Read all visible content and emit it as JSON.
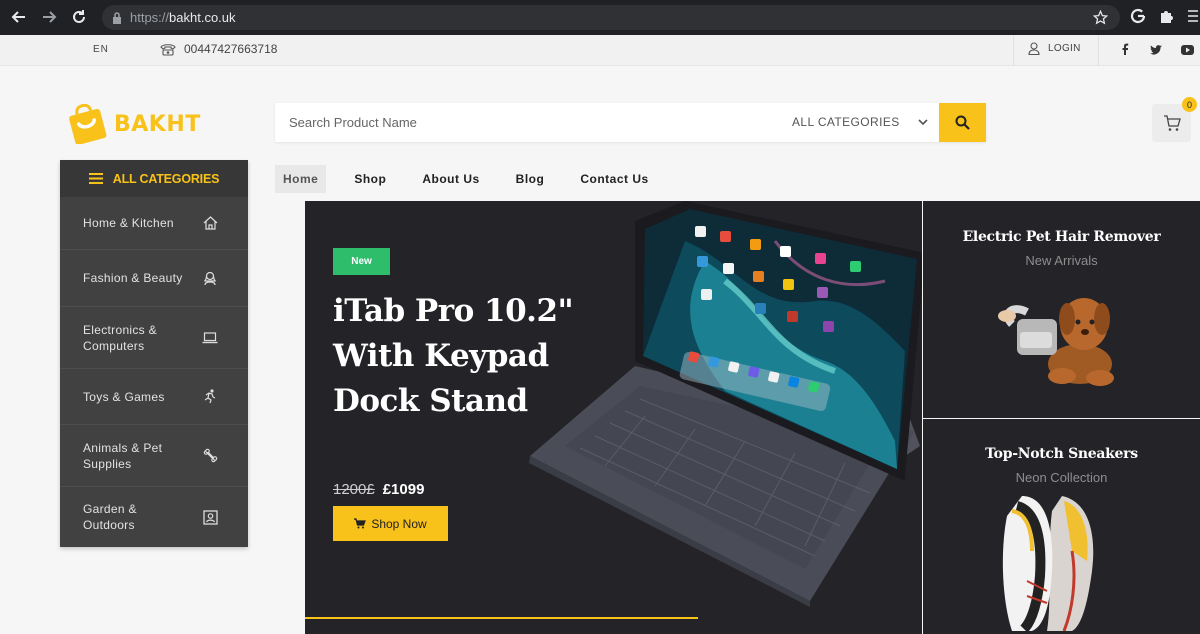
{
  "browser": {
    "url_protocol": "https://",
    "url_host": "bakht.co.uk"
  },
  "topbar": {
    "language": "EN",
    "phone": "00447427663718",
    "login": "LOGIN"
  },
  "brand": {
    "name": "BAKHT",
    "accent_color": "#f8c21a"
  },
  "search": {
    "placeholder": "Search Product Name",
    "category": "ALL CATEGORIES"
  },
  "cart": {
    "count": "0"
  },
  "sidebar": {
    "heading": "ALL CATEGORIES",
    "items": [
      {
        "label": "Home & Kitchen",
        "icon": "home-icon"
      },
      {
        "label": "Fashion & Beauty",
        "icon": "woman-icon"
      },
      {
        "label": "Electronics & Computers",
        "icon": "laptop-icon"
      },
      {
        "label": "Toys & Games",
        "icon": "running-icon"
      },
      {
        "label": "Animals & Pet Supplies",
        "icon": "bone-icon"
      },
      {
        "label": "Garden & Outdoors",
        "icon": "picture-frame-icon"
      }
    ]
  },
  "nav": {
    "items": [
      "Home",
      "Shop",
      "About Us",
      "Blog",
      "Contact Us"
    ],
    "active": "Home"
  },
  "hero": {
    "badge": "New",
    "title": "iTab Pro 10.2\" With Keypad Dock Stand",
    "old_price": "1200£",
    "price": "£1099",
    "button": "Shop Now",
    "badge_color": "#2ebd6b"
  },
  "panels": [
    {
      "title": "Electric Pet Hair Remover",
      "subtitle": "New Arrivals"
    },
    {
      "title": "Top-Notch Sneakers",
      "subtitle": "Neon Collection"
    }
  ]
}
